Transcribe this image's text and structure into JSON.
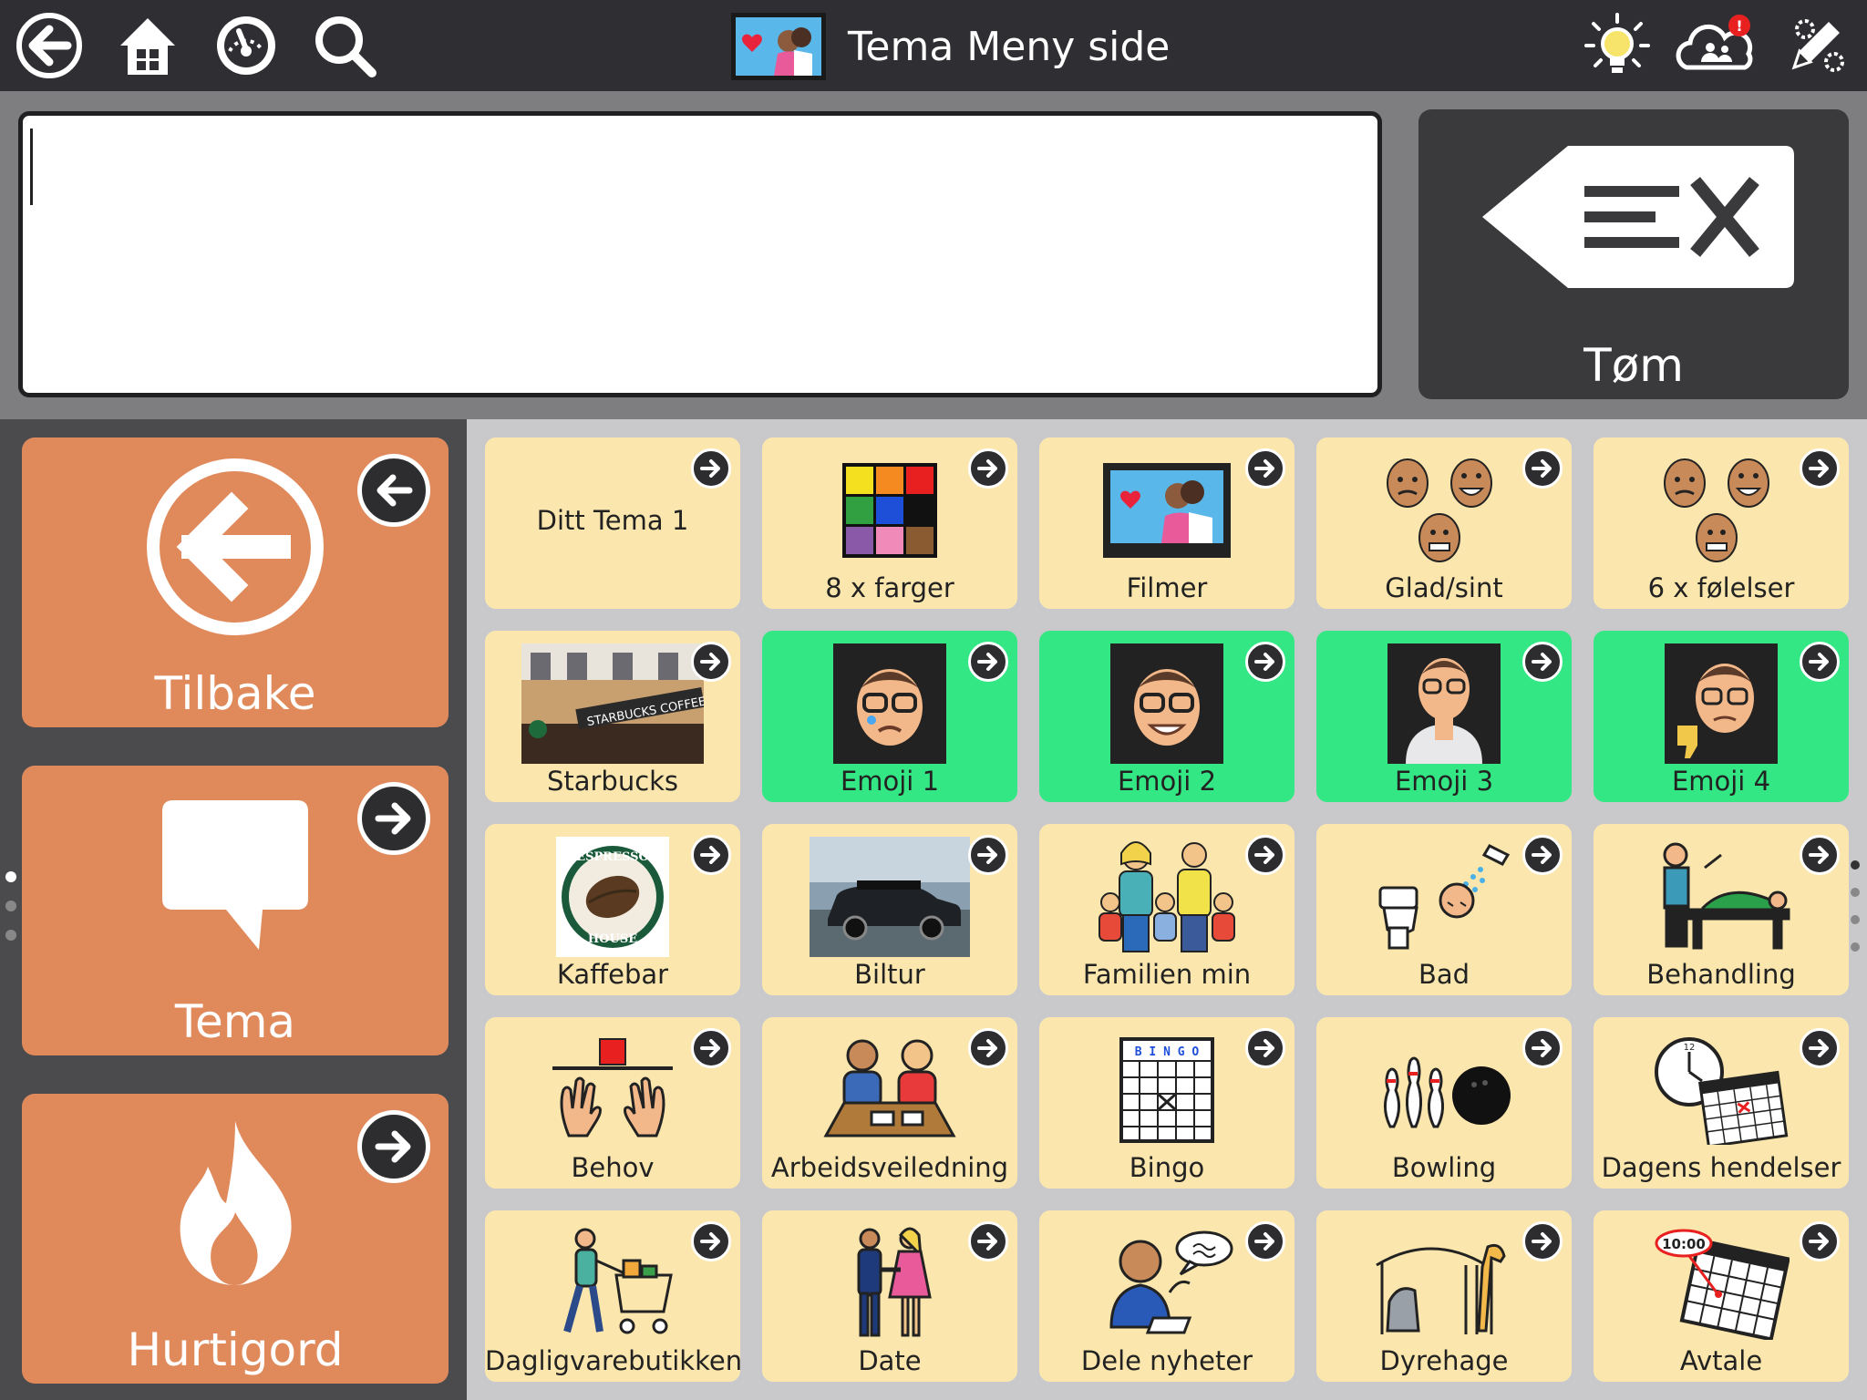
{
  "topbar": {
    "title": "Tema Meny side",
    "left_icons": [
      "back-icon",
      "home-icon",
      "dashboard-icon",
      "search-icon"
    ],
    "right_icons": [
      "lightbulb-icon",
      "cloud-sync-icon",
      "edit-icon"
    ],
    "notification_badge": "!"
  },
  "message": {
    "text": "",
    "clear_label": "Tøm"
  },
  "sidebar": {
    "items": [
      {
        "label": "Tilbake",
        "icon": "back-circle-icon"
      },
      {
        "label": "Tema",
        "icon": "speech-bubble-icon"
      },
      {
        "label": "Hurtigord",
        "icon": "flame-icon"
      }
    ]
  },
  "grid": {
    "rows": [
      [
        {
          "label": "8 x farger",
          "icon": "color-grid-icon"
        },
        {
          "label": "Filmer",
          "icon": "movie-screen-icon"
        },
        {
          "label": "Glad/sint",
          "icon": "emotion-faces-icon"
        },
        {
          "label": "6 x følelser",
          "icon": "emotion-faces-icon"
        }
      ],
      [
        {
          "label": "Starbucks",
          "icon": "starbucks-photo"
        },
        {
          "label": "Emoji 1",
          "icon": "emoji-sad-icon"
        },
        {
          "label": "Emoji 2",
          "icon": "emoji-happy-icon"
        },
        {
          "label": "Emoji 3",
          "icon": "emoji-pray-icon"
        },
        {
          "label": "Emoji 4",
          "icon": "emoji-thumbs-down-icon"
        }
      ],
      [
        {
          "label": "Kaffebar",
          "icon": "espresso-house-logo"
        },
        {
          "label": "Biltur",
          "icon": "car-photo"
        },
        {
          "label": "Familien min",
          "icon": "family-icon"
        },
        {
          "label": "Bad",
          "icon": "bathroom-icon"
        },
        {
          "label": "Behandling",
          "icon": "treatment-icon"
        }
      ],
      [
        {
          "label": "Behov",
          "icon": "needs-icon"
        },
        {
          "label": "Arbeidsveiledning",
          "icon": "work-guidance-icon"
        },
        {
          "label": "Bingo",
          "icon": "bingo-card-icon"
        },
        {
          "label": "Bowling",
          "icon": "bowling-icon"
        },
        {
          "label": "Dagens hendelser",
          "icon": "clock-calendar-icon"
        }
      ],
      [
        {
          "label": "Dagligvarebutikken",
          "icon": "shopping-cart-icon"
        },
        {
          "label": "Date",
          "icon": "couple-icon"
        },
        {
          "label": "Dele nyheter",
          "icon": "share-news-icon"
        },
        {
          "label": "Dyrehage",
          "icon": "zoo-icon"
        },
        {
          "label": "Avtale",
          "icon": "appointment-icon"
        }
      ]
    ],
    "first_cell_text": "Ditt Tema 1",
    "bingo_header": "B I N G O",
    "clock_time": "10:00",
    "clock_twelve": "12",
    "espresso_text_top": "ESPRESSO",
    "espresso_text_bottom": "HOUSE",
    "starbucks_sign": "STARBUCKS COFFEE"
  },
  "colors": {
    "topbar": "#2f2f33",
    "orange": "#e08a5c",
    "cell": "#fbe7ad",
    "green": "#33e884"
  }
}
